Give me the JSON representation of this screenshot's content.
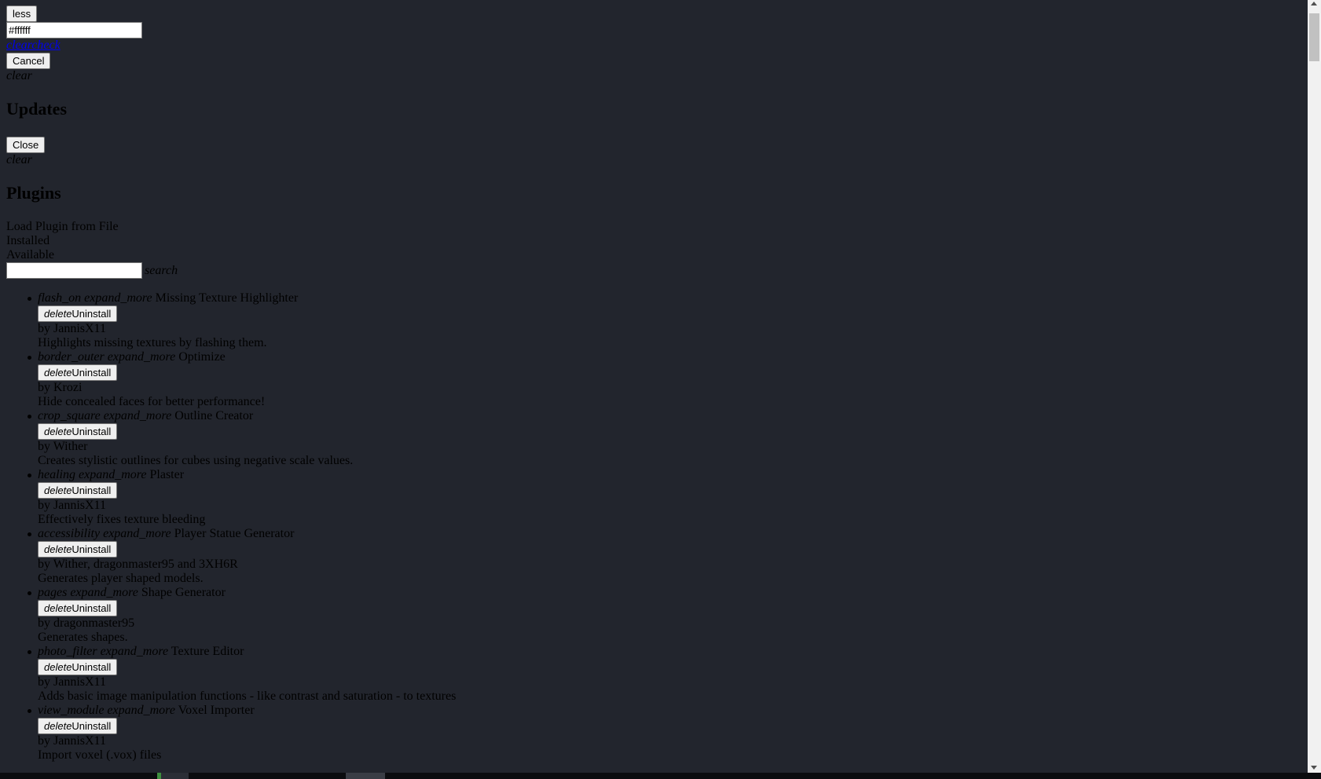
{
  "top": {
    "less_button": "less",
    "color_value": "#ffffff",
    "link_text": "clearcheck",
    "cancel_button": "Cancel",
    "clear_label": "clear"
  },
  "updates": {
    "title": "Updates",
    "close_button": "Close",
    "clear_label": "clear"
  },
  "plugins": {
    "title": "Plugins",
    "load_from_file": "Load Plugin from File",
    "tab_installed": "Installed",
    "tab_available": "Available",
    "search_value": "",
    "search_icon": "search",
    "uninstall_icon": "delete",
    "uninstall_label": "Uninstall",
    "expand_icon": "expand_more",
    "items": [
      {
        "icon": "flash_on",
        "title": "Missing Texture Highlighter",
        "author": "by JannisX11",
        "description": "Highlights missing textures by flashing them."
      },
      {
        "icon": "border_outer",
        "title": "Optimize",
        "author": "by Krozi",
        "description": "Hide concealed faces for better performance!"
      },
      {
        "icon": "crop_square",
        "title": "Outline Creator",
        "author": "by Wither",
        "description": "Creates stylistic outlines for cubes using negative scale values."
      },
      {
        "icon": "healing",
        "title": "Plaster",
        "author": "by JannisX11",
        "description": "Effectively fixes texture bleeding"
      },
      {
        "icon": "accessibility",
        "title": "Player Statue Generator",
        "author": "by Wither, dragonmaster95 and 3XH6R",
        "description": "Generates player shaped models."
      },
      {
        "icon": "pages",
        "title": "Shape Generator",
        "author": "by dragonmaster95",
        "description": "Generates shapes."
      },
      {
        "icon": "photo_filter",
        "title": "Texture Editor",
        "author": "by JannisX11",
        "description": "Adds basic image manipulation functions - like contrast and saturation - to textures"
      },
      {
        "icon": "view_module",
        "title": "Voxel Importer",
        "author": "by JannisX11",
        "description": "Import voxel (.vox) files"
      }
    ]
  },
  "colors": {
    "background": "#22252d",
    "text": "#000000",
    "link": "#0000ee"
  }
}
